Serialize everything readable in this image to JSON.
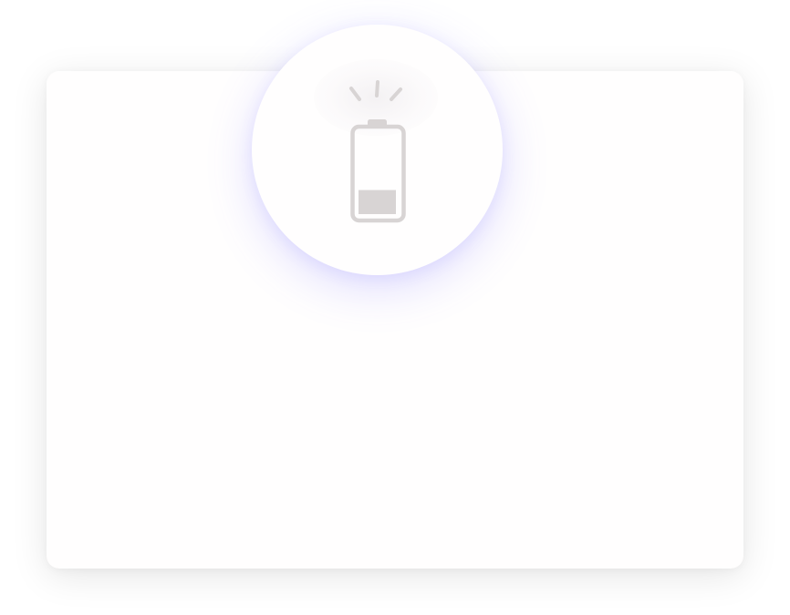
{
  "dialog": {
    "icon": "battery-low-alert-icon",
    "battery_level": 0.3,
    "colors": {
      "background": "#ffffff",
      "card": "#fffefe",
      "icon": "#d8d4d4",
      "badge_glow": "#6e64ff"
    }
  }
}
